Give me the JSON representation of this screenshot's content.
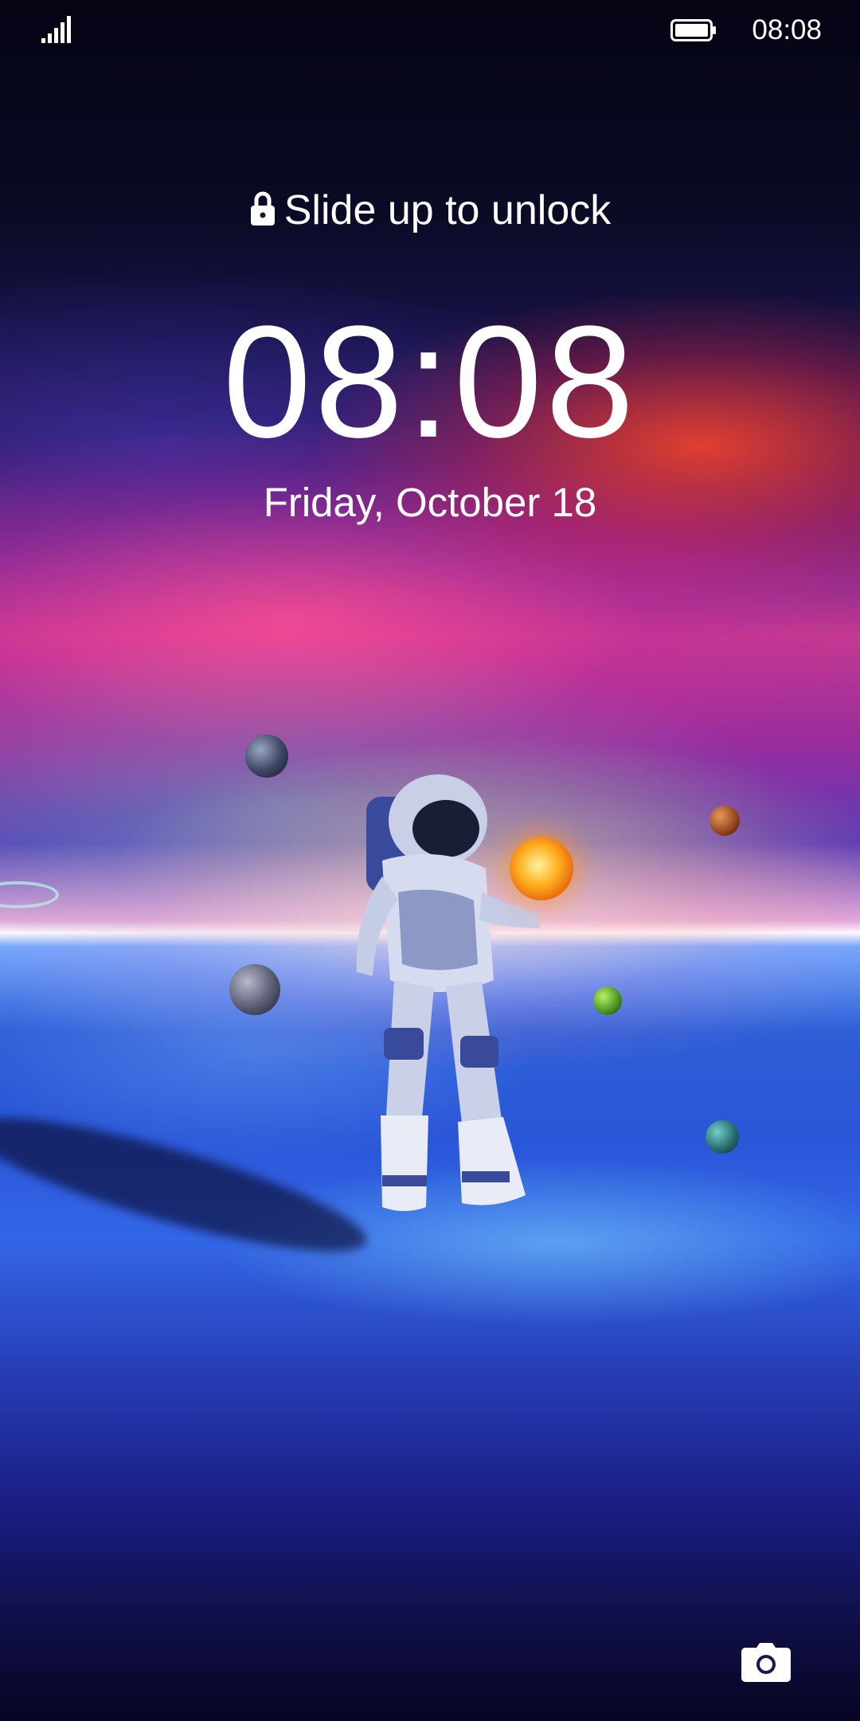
{
  "status_bar": {
    "time": "08:08",
    "signal_icon": "cellular-signal-icon",
    "battery_icon": "battery-icon"
  },
  "lockscreen": {
    "unlock_hint": "Slide up to unlock",
    "lock_icon": "lock-icon",
    "clock": "08:08",
    "date": "Friday, October 18"
  },
  "shortcuts": {
    "camera_icon": "camera-icon"
  }
}
